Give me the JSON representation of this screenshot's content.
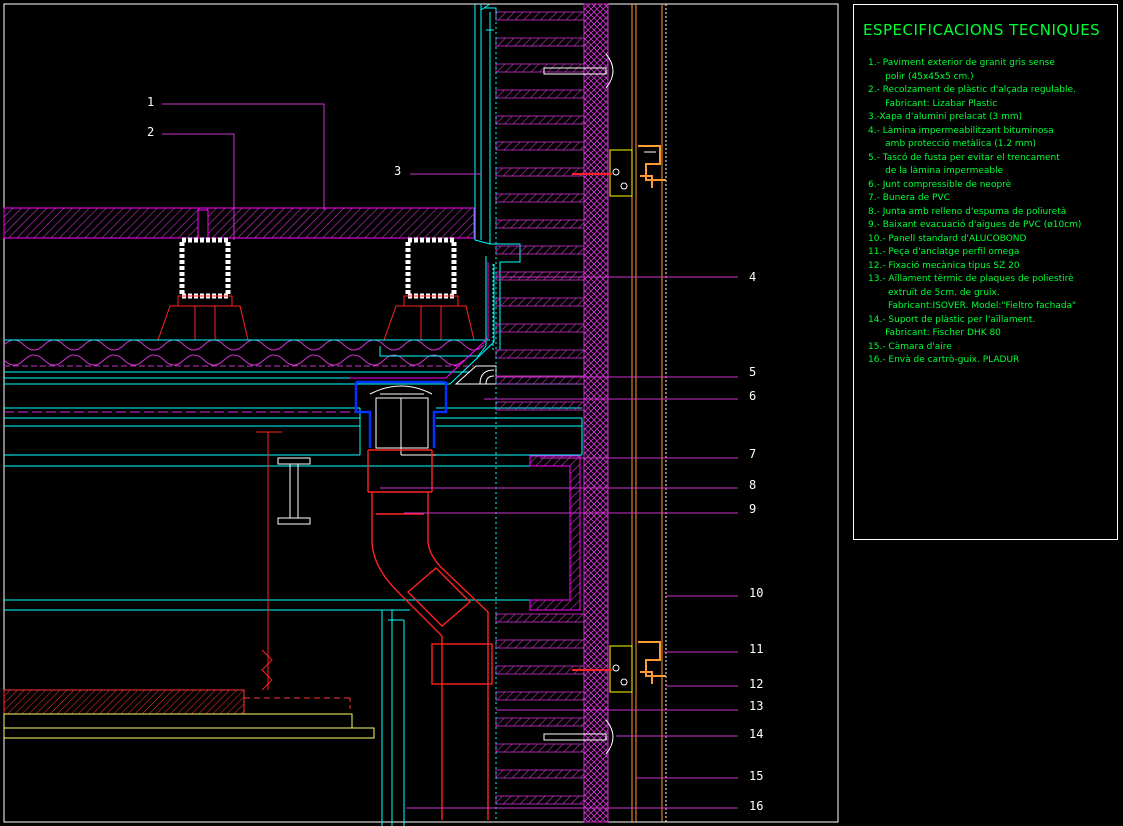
{
  "specs": {
    "title": "ESPECIFICACIONS TECNIQUES",
    "items": [
      "1.- Paviment exterior de granit gris sense\n      polir (45x45x5 cm.)",
      "2.- Recolzament de plàstic d'alçada regulable.\n      Fabricant: Lizabar Plastic",
      "3.-Xapa d'alumini prelacat (3 mm)",
      "4.- Làmina impermeabilitzant bituminosa\n      amb protecció metàlica (1.2 mm)",
      "5.- Tascó de fusta per evitar el trencament\n      de la làmina impermeable",
      "6.- Junt compressible de neoprè",
      "7.- Bunera de PVC",
      "8.- Junta amb relleno d'espuma de poliuretà",
      "9.- Baixant evacuació d'aigues de PVC (ø10cm)",
      "10.- Panell standard d'ALUCOBOND",
      "11.- Peça d'anclatge perfil omega",
      "12.- Fixació mecànica tipus SZ 20",
      "13.- Aïllament tèrmic de plaques de poliestirè\n       extruït de 5cm. de gruix.\n       Fabricant:ISOVER. Model:\"Fieltro fachada\"",
      "14.- Suport de plàstic per l'aïllament.\n      Fabricant: Fischer DHK 80",
      "15.- Càmara d'aire",
      "16.- Envà de cartrò-guix. PLADUR"
    ]
  },
  "callouts": [
    "1",
    "2",
    "3",
    "4",
    "5",
    "6",
    "7",
    "8",
    "9",
    "10",
    "11",
    "12",
    "13",
    "14",
    "15",
    "16"
  ],
  "colors": {
    "background": "#000000",
    "magenta": "#ff00ff",
    "pink": "#cc33cc",
    "cyan": "#00ffff",
    "red": "#ff0000",
    "blue": "#0033ff",
    "yellow": "#ffff00",
    "white": "#ffffff",
    "green": "#00ff33",
    "orange": "#ff9933"
  }
}
